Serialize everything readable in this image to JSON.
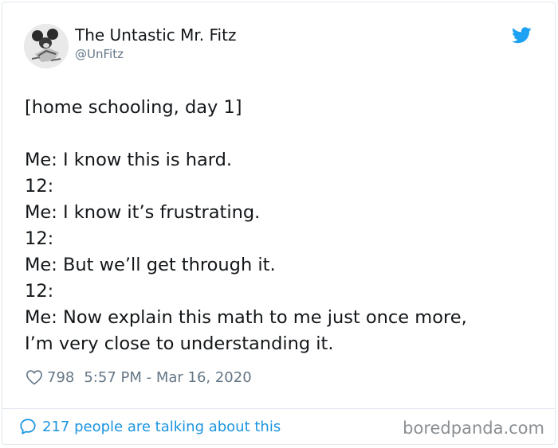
{
  "tweet": {
    "display_name": "The Untastic Mr. Fitz",
    "handle": "@UnFitz",
    "lines": [
      "[home schooling, day 1]",
      "",
      "Me: I know this is hard.",
      "12:",
      "Me: I know it’s frustrating.",
      "12:",
      "Me: But we’ll get through it.",
      "12:",
      "Me: Now explain this math to me just once more,",
      "I’m very close to understanding it."
    ],
    "likes": "798",
    "timestamp": "5:57 PM - Mar 16, 2020",
    "talking": "217 people are talking about this"
  },
  "watermark": "boredpanda.com",
  "colors": {
    "twitter_blue": "#1da1f2",
    "link_blue": "#1b95e0",
    "muted_gray": "#657786"
  },
  "icons": {
    "logo": "twitter-bird-icon",
    "likes": "heart-icon",
    "talking": "speech-bubble-icon"
  }
}
